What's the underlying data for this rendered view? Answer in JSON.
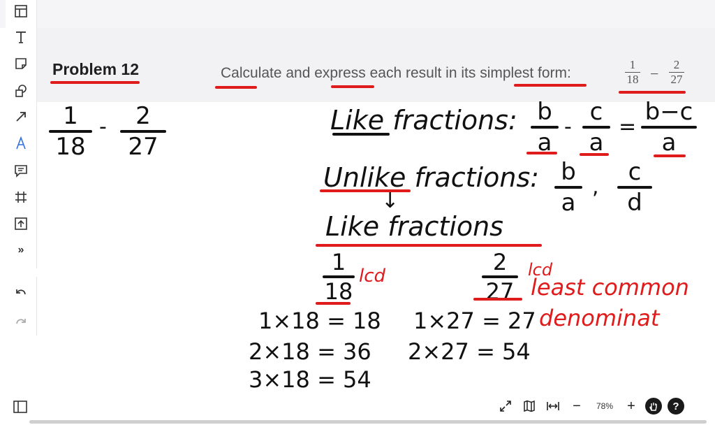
{
  "toolbar": {
    "tools": [
      "layout-icon",
      "text-icon",
      "sticky-note-icon",
      "shapes-icon",
      "arrow-icon",
      "pen-icon",
      "comment-icon",
      "frame-icon",
      "upload-icon",
      "more-icon"
    ],
    "more_label": "»"
  },
  "header": {
    "problem_title": "Problem 12",
    "instruction": "Calculate and express each result in its simplest form:",
    "fraction1": {
      "num": "1",
      "den": "18"
    },
    "operator": "−",
    "fraction2": {
      "num": "2",
      "den": "27"
    }
  },
  "canvas": {
    "left_problem": {
      "num1": "1",
      "den1": "18",
      "op": "-",
      "num2": "2",
      "den2": "27"
    },
    "like_label": "Like fractions:",
    "like_formula": {
      "n1": "b",
      "d1": "a",
      "op": "-",
      "n2": "c",
      "d2": "a",
      "eq": "=",
      "n3": "b−c",
      "d3": "a"
    },
    "unlike_label": "Unlike fractions:",
    "unlike_formula": {
      "n1": "b",
      "d1": "a",
      "sep": ",",
      "n2": "c",
      "d2": "d"
    },
    "arrow": "↓",
    "like_label2": "Like fractions",
    "frac_a": {
      "num": "1",
      "den": "18"
    },
    "frac_b": {
      "num": "2",
      "den": "27"
    },
    "lcd_mark": "lcd",
    "lcd_line1": "least common",
    "lcd_line2": "denominat",
    "mult18": [
      "1×18 = 18",
      "2×18 = 36",
      "3×18 = 54"
    ],
    "mult27": [
      "1×27 = 27",
      "2×27 = 54"
    ]
  },
  "controls": {
    "zoom": "78%",
    "minus": "−",
    "plus": "+",
    "help": "?"
  },
  "colors": {
    "ink": "#111111",
    "annotation": "#e01b1b"
  }
}
